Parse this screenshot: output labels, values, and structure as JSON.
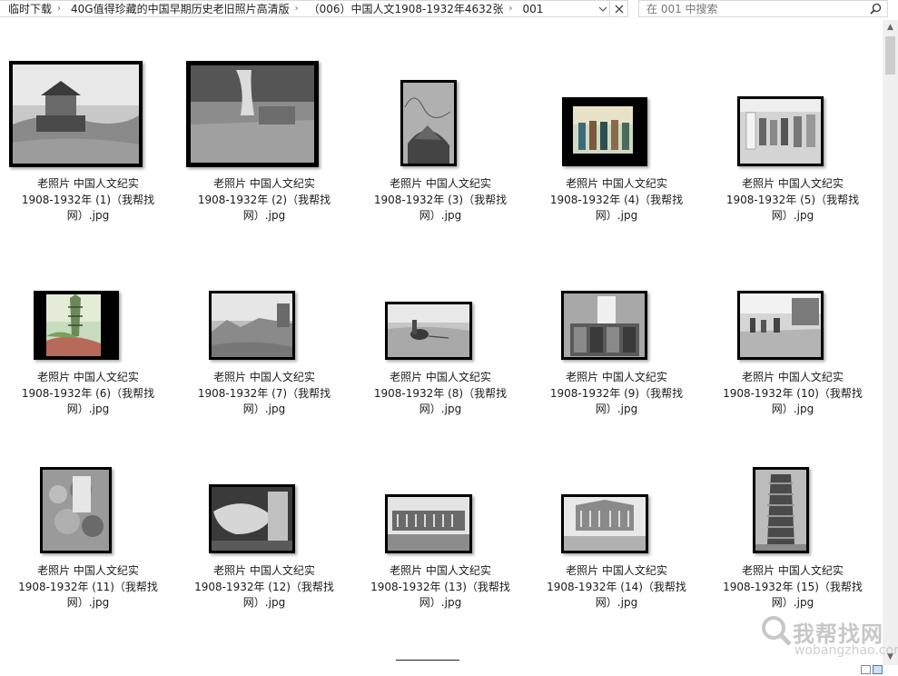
{
  "breadcrumb": {
    "items": [
      "临时下载",
      "40G值得珍藏的中国早期历史老旧照片高清版",
      "（006）中国人文1908-1932年4632张",
      "001"
    ]
  },
  "search": {
    "placeholder": "在 001 中搜索"
  },
  "icons": {
    "separator": "chevron-right-icon",
    "dropdown": "chevron-down-icon",
    "close": "close-icon",
    "search": "search-icon",
    "scroll_up": "triangle-up-icon",
    "scroll_down": "triangle-down-icon"
  },
  "files": [
    {
      "line1": "老照片 中国人文纪实",
      "line2": "1908-1932年 (1)（我帮找",
      "line3": "网）.jpg"
    },
    {
      "line1": "老照片 中国人文纪实",
      "line2": "1908-1932年 (2)（我帮找",
      "line3": "网）.jpg"
    },
    {
      "line1": "老照片 中国人文纪实",
      "line2": "1908-1932年 (3)（我帮找",
      "line3": "网）.jpg"
    },
    {
      "line1": "老照片 中国人文纪实",
      "line2": "1908-1932年 (4)（我帮找",
      "line3": "网）.jpg"
    },
    {
      "line1": "老照片 中国人文纪实",
      "line2": "1908-1932年 (5)（我帮找",
      "line3": "网）.jpg"
    },
    {
      "line1": "老照片 中国人文纪实",
      "line2": "1908-1932年 (6)（我帮找",
      "line3": "网）.jpg"
    },
    {
      "line1": "老照片 中国人文纪实",
      "line2": "1908-1932年 (7)（我帮找",
      "line3": "网）.jpg"
    },
    {
      "line1": "老照片 中国人文纪实",
      "line2": "1908-1932年 (8)（我帮找",
      "line3": "网）.jpg"
    },
    {
      "line1": "老照片 中国人文纪实",
      "line2": "1908-1932年 (9)（我帮找",
      "line3": "网）.jpg"
    },
    {
      "line1": "老照片 中国人文纪实",
      "line2": "1908-1932年 (10)（我帮找",
      "line3": "网）.jpg"
    },
    {
      "line1": "老照片 中国人文纪实",
      "line2": "1908-1932年 (11)（我帮找",
      "line3": "网）.jpg"
    },
    {
      "line1": "老照片 中国人文纪实",
      "line2": "1908-1932年 (12)（我帮找",
      "line3": "网）.jpg"
    },
    {
      "line1": "老照片 中国人文纪实",
      "line2": "1908-1932年 (13)（我帮找",
      "line3": "网）.jpg"
    },
    {
      "line1": "老照片 中国人文纪实",
      "line2": "1908-1932年 (14)（我帮找",
      "line3": "网）.jpg"
    },
    {
      "line1": "老照片 中国人文纪实",
      "line2": "1908-1932年 (15)（我帮找",
      "line3": "网）.jpg"
    }
  ],
  "watermark": {
    "brand": "我帮找网",
    "url": "wobangzhao.com"
  }
}
